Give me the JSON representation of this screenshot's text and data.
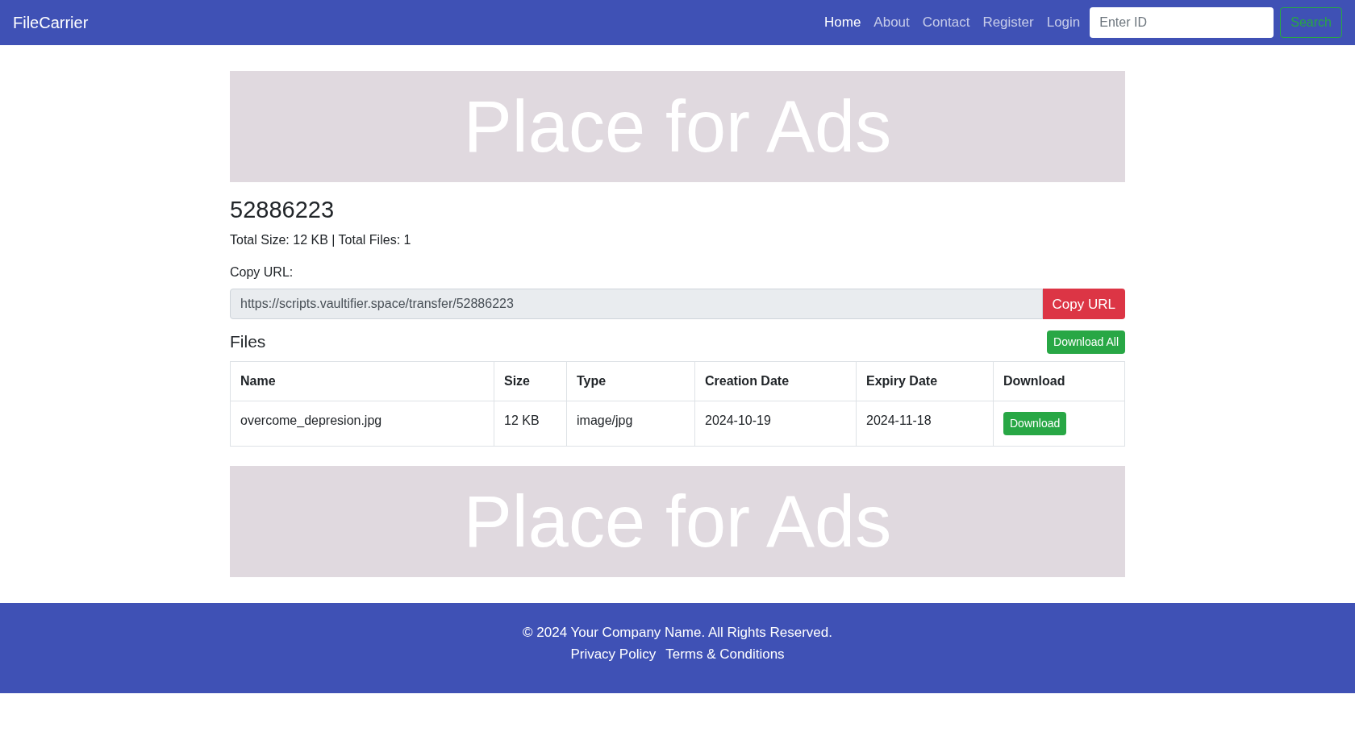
{
  "navbar": {
    "brand": "FileCarrier",
    "links": [
      {
        "label": "Home",
        "selected": true
      },
      {
        "label": "About",
        "selected": false
      },
      {
        "label": "Contact",
        "selected": false
      },
      {
        "label": "Register",
        "selected": false
      },
      {
        "label": "Login",
        "selected": false
      }
    ],
    "search": {
      "placeholder": "Enter ID",
      "button": "Search"
    }
  },
  "ads": [
    "Place for Ads",
    "Place for Ads"
  ],
  "transfer": {
    "id": "52886223",
    "summary": "Total Size: 12 KB | Total Files: 1",
    "copy_label": "Copy URL:",
    "url": "https://scripts.vaultifier.space/transfer/52886223",
    "copy_button": "Copy URL"
  },
  "files": {
    "title": "Files",
    "download_all": "Download All",
    "columns": [
      "Name",
      "Size",
      "Type",
      "Creation Date",
      "Expiry Date",
      "Download"
    ],
    "rows": [
      {
        "name": "overcome_depresion.jpg",
        "size": "12 KB",
        "type": "image/jpg",
        "created": "2024-10-19",
        "expires": "2024-11-18",
        "button": "Download"
      }
    ]
  },
  "footer": {
    "copyright": "© 2024 Your Company Name. All Rights Reserved.",
    "links": [
      "Privacy Policy",
      "Terms & Conditions"
    ]
  }
}
